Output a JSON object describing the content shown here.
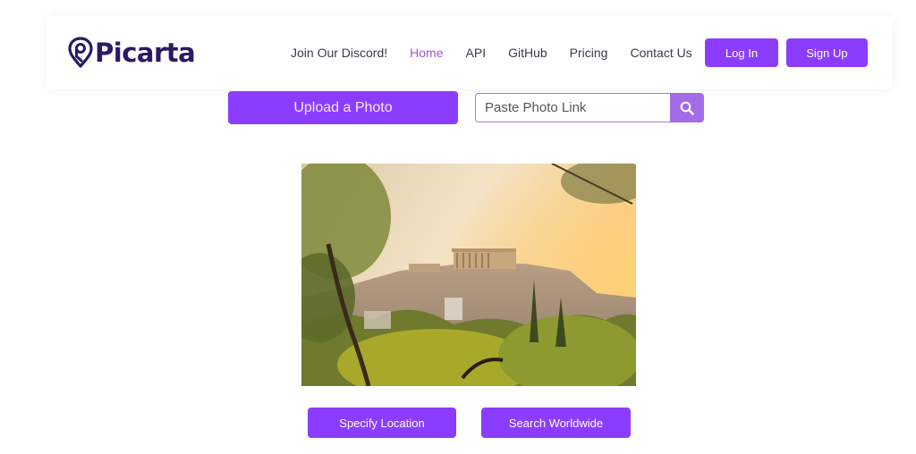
{
  "brand": {
    "name": "Picarta",
    "logo_icon": "map-pin-p-icon",
    "color": "#2a1a66"
  },
  "nav": {
    "items": [
      {
        "label": "Join Our Discord!",
        "active": false
      },
      {
        "label": "Home",
        "active": true
      },
      {
        "label": "API",
        "active": false
      },
      {
        "label": "GitHub",
        "active": false
      },
      {
        "label": "Pricing",
        "active": false
      },
      {
        "label": "Contact Us",
        "active": false
      }
    ],
    "login_label": "Log In",
    "signup_label": "Sign Up"
  },
  "upload": {
    "upload_label": "Upload a Photo",
    "link_placeholder": "Paste Photo Link",
    "link_value": "",
    "search_icon": "search-icon"
  },
  "photo": {
    "description": "Acropolis of Athens at sunset framed by trees"
  },
  "actions": {
    "specify_label": "Specify Location",
    "worldwide_label": "Search Worldwide"
  },
  "colors": {
    "accent": "#8b3dff",
    "search_button": "#a46be8",
    "active_nav": "#9b59d6"
  }
}
